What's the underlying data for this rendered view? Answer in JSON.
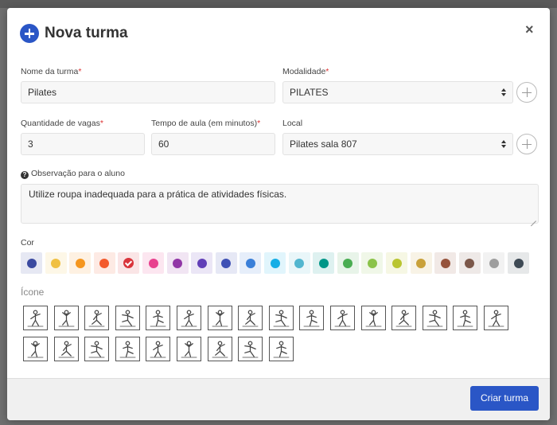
{
  "modal": {
    "title": "Nova turma",
    "close_label": "×",
    "submit_label": "Criar turma"
  },
  "form": {
    "nome": {
      "label": "Nome da turma",
      "required_mark": "*",
      "value": "Pilates"
    },
    "modalidade": {
      "label": "Modalidade",
      "required_mark": "*",
      "value": "PILATES"
    },
    "vagas": {
      "label": "Quantidade de vagas",
      "required_mark": "*",
      "value": "3"
    },
    "tempo": {
      "label": "Tempo de aula (em minutos)",
      "required_mark": "*",
      "value": "60"
    },
    "local": {
      "label": "Local",
      "value": "Pilates sala 807"
    },
    "observacao": {
      "label": "Observação para o aluno",
      "value": "Utilize roupa inadequada para a prática de atividades físicas."
    }
  },
  "cor": {
    "label": "Cor",
    "selected_index": 4,
    "colors": [
      "#3b4aa0",
      "#f0c043",
      "#f5961e",
      "#f35a2c",
      "#d9343b",
      "#e8418e",
      "#9137a6",
      "#613fb7",
      "#3f51b5",
      "#3a7fd8",
      "#16aee6",
      "#52b6cf",
      "#009688",
      "#4aad52",
      "#8bc34a",
      "#b9c531",
      "#c9a13a",
      "#96533c",
      "#7b5749",
      "#9e9e9e",
      "#3e4a55"
    ]
  },
  "icone": {
    "label": "Ícone",
    "icons": [
      "boxing-icon",
      "soccer-icon",
      "cycling-icon",
      "basketball-icon",
      "martial-arts-icon",
      "gymnastics-icon",
      "karate-icon",
      "volleyball-icon",
      "meditation-icon",
      "running-kick-icon",
      "weightlifting-icon",
      "yoga-ball-icon",
      "sprint-icon",
      "dance-icon",
      "swimming-icon",
      "stretching-icon",
      "pool-icon",
      "treadmill-icon",
      "stairs-icon",
      "boot-icon",
      "tennis-icon",
      "water-bottle-icon",
      "aqua-fitness-icon",
      "barbell-icon",
      "wrestling-icon"
    ]
  }
}
